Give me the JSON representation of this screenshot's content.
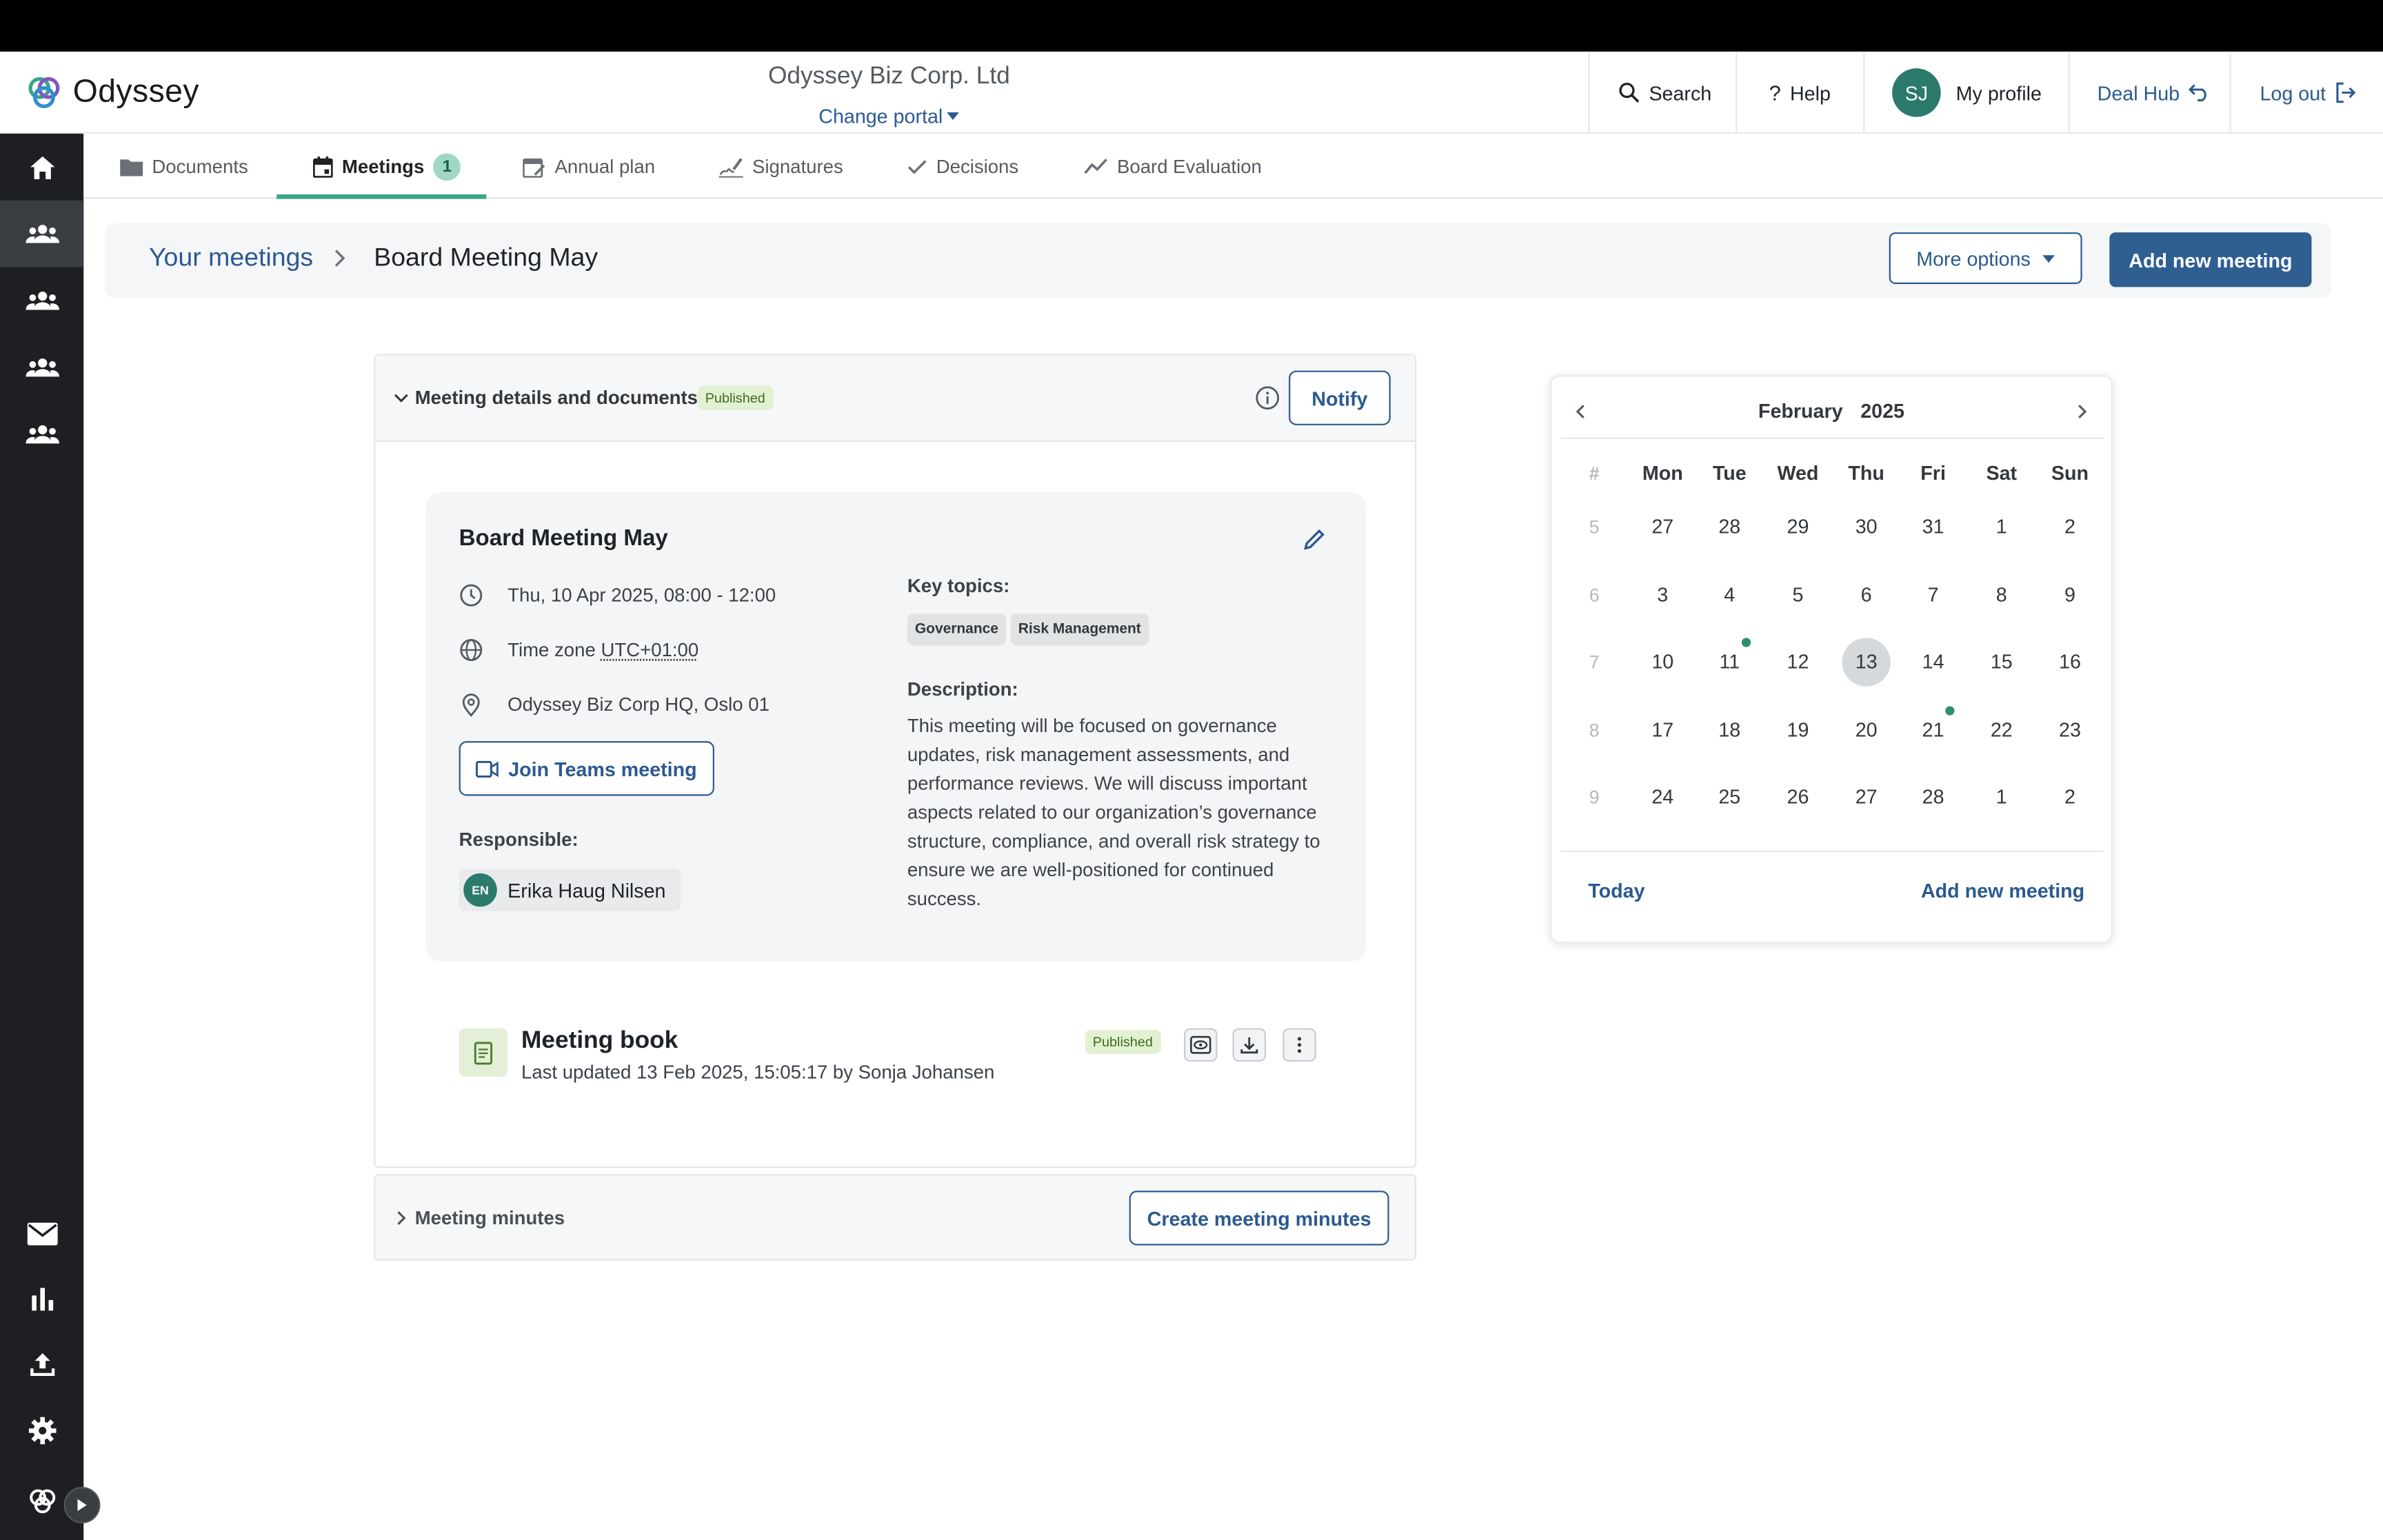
{
  "app": {
    "name": "Odyssey",
    "portal_name": "Odyssey Biz Corp. Ltd",
    "change_portal_label": "Change portal"
  },
  "header": {
    "search_label": "Search",
    "help_label": "Help",
    "profile_initials": "SJ",
    "profile_label": "My profile",
    "dealhub_label": "Deal Hub",
    "logout_label": "Log out"
  },
  "sidebar": {
    "top_icons": [
      "home-icon",
      "users-icon",
      "users-icon",
      "users-icon",
      "users-icon"
    ],
    "bottom_icons": [
      "mail-icon",
      "bar-chart-icon",
      "upload-icon",
      "gear-icon",
      "odyssey-logo-icon"
    ]
  },
  "tabs": [
    {
      "label": "Documents",
      "icon": "folder-icon"
    },
    {
      "label": "Meetings",
      "icon": "calendar-icon",
      "badge": "1",
      "active": true
    },
    {
      "label": "Annual plan",
      "icon": "calendar-edit-icon"
    },
    {
      "label": "Signatures",
      "icon": "signature-icon"
    },
    {
      "label": "Decisions",
      "icon": "check-icon"
    },
    {
      "label": "Board Evaluation",
      "icon": "trend-icon"
    }
  ],
  "breadcrumb": {
    "root": "Your meetings",
    "current": "Board Meeting May"
  },
  "actions": {
    "more_options": "More options",
    "add_new_meeting": "Add new meeting"
  },
  "panel": {
    "title": "Meeting details and documents",
    "status": "Published",
    "notify_label": "Notify"
  },
  "meeting": {
    "title": "Board Meeting May",
    "datetime": "Thu, 10 Apr 2025, 08:00 - 12:00",
    "timezone_prefix": "Time zone",
    "timezone_value": "UTC+01:00",
    "location": "Odyssey Biz Corp HQ, Oslo 01",
    "join_label": "Join Teams meeting",
    "responsible_label": "Responsible:",
    "responsible_initials": "EN",
    "responsible_name": "Erika Haug Nilsen",
    "key_topics_label": "Key topics:",
    "key_topics": [
      "Governance",
      "Risk Management"
    ],
    "description_label": "Description:",
    "description": "This meeting will be focused on governance updates, risk management assessments, and performance reviews. We will discuss important aspects related to our organization’s governance structure, compliance, and overall risk strategy to ensure we are well-positioned for continued success."
  },
  "meeting_book": {
    "title": "Meeting book",
    "updated": "Last updated 13 Feb 2025, 15:05:17 by Sonja Johansen",
    "status": "Published"
  },
  "minutes": {
    "title": "Meeting minutes",
    "create_label": "Create meeting minutes"
  },
  "calendar": {
    "month": "February",
    "year": "2025",
    "week_header": "#",
    "weekdays": [
      "Mon",
      "Tue",
      "Wed",
      "Thu",
      "Fri",
      "Sat",
      "Sun"
    ],
    "weeks": [
      {
        "week": "5",
        "days": [
          "27",
          "28",
          "29",
          "30",
          "31",
          "1",
          "2"
        ]
      },
      {
        "week": "6",
        "days": [
          "3",
          "4",
          "5",
          "6",
          "7",
          "8",
          "9"
        ]
      },
      {
        "week": "7",
        "days": [
          "10",
          "11",
          "12",
          "13",
          "14",
          "15",
          "16"
        ]
      },
      {
        "week": "8",
        "days": [
          "17",
          "18",
          "19",
          "20",
          "21",
          "22",
          "23"
        ]
      },
      {
        "week": "9",
        "days": [
          "24",
          "25",
          "26",
          "27",
          "28",
          "1",
          "2"
        ]
      }
    ],
    "today": "13",
    "event_days": [
      "11",
      "21"
    ],
    "today_label": "Today",
    "add_label": "Add new meeting",
    "accent_color": "#2e8f6f"
  },
  "colors": {
    "brand_blue": "#2f5e91",
    "accent_green": "#3aa68a",
    "sidebar_bg": "#1d1f22"
  }
}
